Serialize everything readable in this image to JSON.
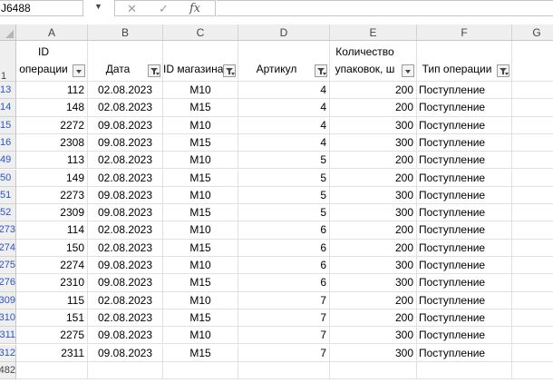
{
  "name_box": "J6488",
  "formula_value": "",
  "column_letters": [
    "A",
    "B",
    "C",
    "D",
    "E",
    "F",
    "G"
  ],
  "header_row_number": "1",
  "headers": [
    {
      "line1": "ID",
      "line2": "операции",
      "filter": "dropdown"
    },
    {
      "line1": "",
      "line2": "Дата",
      "filter": "funnel"
    },
    {
      "line1": "",
      "line2": "ID магазина",
      "filter": "funnel"
    },
    {
      "line1": "",
      "line2": "Артикул",
      "filter": "funnel"
    },
    {
      "line1": "Количество",
      "line2": "упаковок, ш",
      "filter": "dropdown"
    },
    {
      "line1": "",
      "line2": "Тип операции",
      "filter": "funnel"
    }
  ],
  "rows": [
    {
      "num": "13",
      "id": "112",
      "date": "02.08.2023",
      "shop": "M10",
      "art": "4",
      "qty": "200",
      "type": "Поступление"
    },
    {
      "num": "14",
      "id": "148",
      "date": "02.08.2023",
      "shop": "M15",
      "art": "4",
      "qty": "200",
      "type": "Поступление"
    },
    {
      "num": "15",
      "id": "2272",
      "date": "09.08.2023",
      "shop": "M10",
      "art": "4",
      "qty": "300",
      "type": "Поступление"
    },
    {
      "num": "16",
      "id": "2308",
      "date": "09.08.2023",
      "shop": "M15",
      "art": "4",
      "qty": "300",
      "type": "Поступление"
    },
    {
      "num": "49",
      "id": "113",
      "date": "02.08.2023",
      "shop": "M10",
      "art": "5",
      "qty": "200",
      "type": "Поступление"
    },
    {
      "num": "50",
      "id": "149",
      "date": "02.08.2023",
      "shop": "M15",
      "art": "5",
      "qty": "200",
      "type": "Поступление"
    },
    {
      "num": "51",
      "id": "2273",
      "date": "09.08.2023",
      "shop": "M10",
      "art": "5",
      "qty": "300",
      "type": "Поступление"
    },
    {
      "num": "52",
      "id": "2309",
      "date": "09.08.2023",
      "shop": "M15",
      "art": "5",
      "qty": "300",
      "type": "Поступление"
    },
    {
      "num": "273",
      "id": "114",
      "date": "02.08.2023",
      "shop": "M10",
      "art": "6",
      "qty": "200",
      "type": "Поступление"
    },
    {
      "num": "274",
      "id": "150",
      "date": "02.08.2023",
      "shop": "M15",
      "art": "6",
      "qty": "200",
      "type": "Поступление"
    },
    {
      "num": "275",
      "id": "2274",
      "date": "09.08.2023",
      "shop": "M10",
      "art": "6",
      "qty": "300",
      "type": "Поступление"
    },
    {
      "num": "276",
      "id": "2310",
      "date": "09.08.2023",
      "shop": "M15",
      "art": "6",
      "qty": "300",
      "type": "Поступление"
    },
    {
      "num": "309",
      "id": "115",
      "date": "02.08.2023",
      "shop": "M10",
      "art": "7",
      "qty": "200",
      "type": "Поступление"
    },
    {
      "num": "310",
      "id": "151",
      "date": "02.08.2023",
      "shop": "M15",
      "art": "7",
      "qty": "200",
      "type": "Поступление"
    },
    {
      "num": "311",
      "id": "2275",
      "date": "09.08.2023",
      "shop": "M10",
      "art": "7",
      "qty": "300",
      "type": "Поступление"
    },
    {
      "num": "312",
      "id": "2311",
      "date": "09.08.2023",
      "shop": "M15",
      "art": "7",
      "qty": "300",
      "type": "Поступление"
    }
  ],
  "last_row_number": "482",
  "colors": {
    "filtered_row_number": "#2b54c8",
    "header_bg": "#efefef",
    "gridline": "#e1e1e1"
  },
  "icons": {
    "cancel": "close-icon",
    "enter": "check-icon",
    "function": "fx-icon",
    "namebox_dropdown": "chevron-down-icon"
  }
}
